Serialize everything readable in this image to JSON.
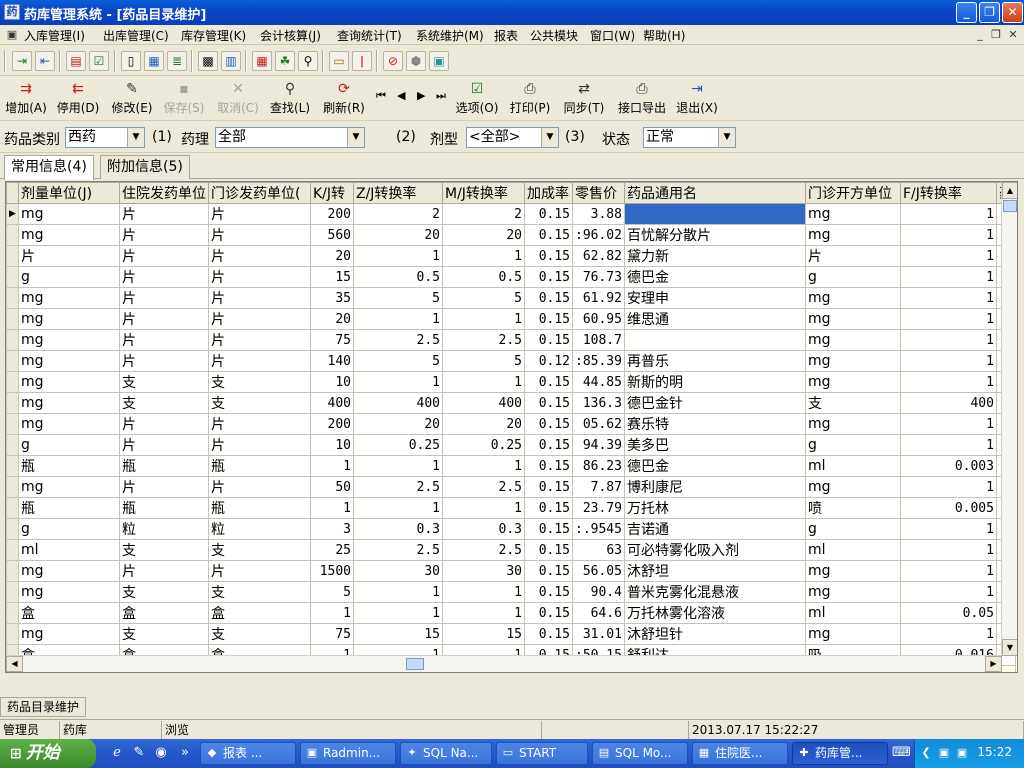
{
  "window": {
    "title": "药库管理系统 - [药品目录维护]",
    "title_icon": "app-icon",
    "min_label": "_",
    "max_label": "❐",
    "close_label": "✕"
  },
  "menu": [
    "入库管理(I)",
    "出库管理(C)",
    "库存管理(K)",
    "会计核算(J)",
    "查询统计(T)",
    "系统维护(M)",
    "报表",
    "公共模块",
    "窗口(W)",
    "帮助(H)"
  ],
  "mdi_controls": [
    "_",
    "❐",
    "✕"
  ],
  "toolbar_icons": [
    "login-icon",
    "logout-icon",
    "document-red-icon",
    "checkbox-icon",
    "clipboard-icon",
    "card-icon",
    "list-icon",
    "calculator-icon",
    "table-icon",
    "grid-icon",
    "people-icon",
    "magnifier-icon",
    "folder-icon",
    "thermometer-icon",
    "stop-icon",
    "hexagon-icon",
    "teal-icon"
  ],
  "actions": {
    "add": "增加(A)",
    "disable": "停用(D)",
    "modify": "修改(E)",
    "save": "保存(S)",
    "cancel": "取消(C)",
    "find": "查找(L)",
    "refresh": "刷新(R)",
    "options": "选项(O)",
    "print": "打印(P)",
    "sync": "同步(T)",
    "export": "接口导出",
    "exit": "退出(X)"
  },
  "filter": {
    "category_label": "药品类别",
    "category_value": "西药",
    "marker1": "(1)",
    "pharmacology_label": "药理",
    "pharmacology_value": "全部",
    "marker2": "(2)",
    "dosage_label": "剂型",
    "dosage_value": "<全部>",
    "marker3": "(3)",
    "status_label": "状态",
    "status_value": "正常"
  },
  "tabs": [
    "常用信息(4)",
    "附加信息(5)"
  ],
  "table": {
    "columns": [
      "剂量单位(J)",
      "住院发药单位",
      "门诊发药单位(",
      "K/J转",
      "Z/J转换率",
      "M/J转换率",
      "加成率",
      "零售价",
      "药品通用名",
      "门诊开方单位",
      "F/J转换率",
      "药"
    ],
    "rows": [
      [
        "mg",
        "片",
        "片",
        "200",
        "2",
        "2",
        "0.15",
        "3.88",
        "",
        "mg",
        "1"
      ],
      [
        "mg",
        "片",
        "片",
        "560",
        "20",
        "20",
        "0.15",
        ":96.02",
        "百忧解分散片",
        "mg",
        "1"
      ],
      [
        "片",
        "片",
        "片",
        "20",
        "1",
        "1",
        "0.15",
        "62.82",
        "黛力新",
        "片",
        "1"
      ],
      [
        "g",
        "片",
        "片",
        "15",
        "0.5",
        "0.5",
        "0.15",
        "76.73",
        "德巴金",
        "g",
        "1"
      ],
      [
        "mg",
        "片",
        "片",
        "35",
        "5",
        "5",
        "0.15",
        "61.92",
        "安理申",
        "mg",
        "1"
      ],
      [
        "mg",
        "片",
        "片",
        "20",
        "1",
        "1",
        "0.15",
        "60.95",
        "维思通",
        "mg",
        "1"
      ],
      [
        "mg",
        "片",
        "片",
        "75",
        "2.5",
        "2.5",
        "0.15",
        "108.7",
        "",
        "mg",
        "1"
      ],
      [
        "mg",
        "片",
        "片",
        "140",
        "5",
        "5",
        "0.12",
        ":85.39",
        "再普乐",
        "mg",
        "1"
      ],
      [
        "mg",
        "支",
        "支",
        "10",
        "1",
        "1",
        "0.15",
        "44.85",
        "新斯的明",
        "mg",
        "1"
      ],
      [
        "mg",
        "支",
        "支",
        "400",
        "400",
        "400",
        "0.15",
        "136.3",
        "德巴金针",
        "支",
        "400"
      ],
      [
        "mg",
        "片",
        "片",
        "200",
        "20",
        "20",
        "0.15",
        "05.62",
        "赛乐特",
        "mg",
        "1"
      ],
      [
        "g",
        "片",
        "片",
        "10",
        "0.25",
        "0.25",
        "0.15",
        "94.39",
        "美多巴",
        "g",
        "1"
      ],
      [
        "瓶",
        "瓶",
        "瓶",
        "1",
        "1",
        "1",
        "0.15",
        "86.23",
        "德巴金",
        "ml",
        "0.003"
      ],
      [
        "mg",
        "片",
        "片",
        "50",
        "2.5",
        "2.5",
        "0.15",
        "7.87",
        "博利康尼",
        "mg",
        "1"
      ],
      [
        "瓶",
        "瓶",
        "瓶",
        "1",
        "1",
        "1",
        "0.15",
        "23.79",
        "万托林",
        "喷",
        "0.005"
      ],
      [
        "g",
        "粒",
        "粒",
        "3",
        "0.3",
        "0.3",
        "0.15",
        ":.9545",
        "吉诺通",
        "g",
        "1"
      ],
      [
        "ml",
        "支",
        "支",
        "25",
        "2.5",
        "2.5",
        "0.15",
        "63",
        "可必特雾化吸入剂",
        "ml",
        "1"
      ],
      [
        "mg",
        "片",
        "片",
        "1500",
        "30",
        "30",
        "0.15",
        "56.05",
        "沐舒坦",
        "mg",
        "1"
      ],
      [
        "mg",
        "支",
        "支",
        "5",
        "1",
        "1",
        "0.15",
        "90.4",
        "普米克雾化混悬液",
        "mg",
        "1"
      ],
      [
        "盒",
        "盒",
        "盒",
        "1",
        "1",
        "1",
        "0.15",
        "64.6",
        "万托林雾化溶液",
        "ml",
        "0.05"
      ],
      [
        "mg",
        "支",
        "支",
        "75",
        "15",
        "15",
        "0.15",
        "31.01",
        "沐舒坦针",
        "mg",
        "1"
      ],
      [
        "盒",
        "盒",
        "盒",
        "1",
        "1",
        "1",
        "0.15",
        ":50.15",
        "舒利达",
        "吸",
        "0.016"
      ]
    ]
  },
  "doc_tab": "药品目录维护",
  "status": {
    "user": "管理员",
    "dept": "药库",
    "mode": "浏览",
    "datetime": "2013.07.17 15:22:27"
  },
  "taskbar": {
    "start": "开始",
    "buttons": [
      "报表 ...",
      "Radmin...",
      "SQL Na...",
      "START",
      "SQL Mo...",
      "住院医...",
      "药库管..."
    ],
    "clock": "15:22"
  }
}
